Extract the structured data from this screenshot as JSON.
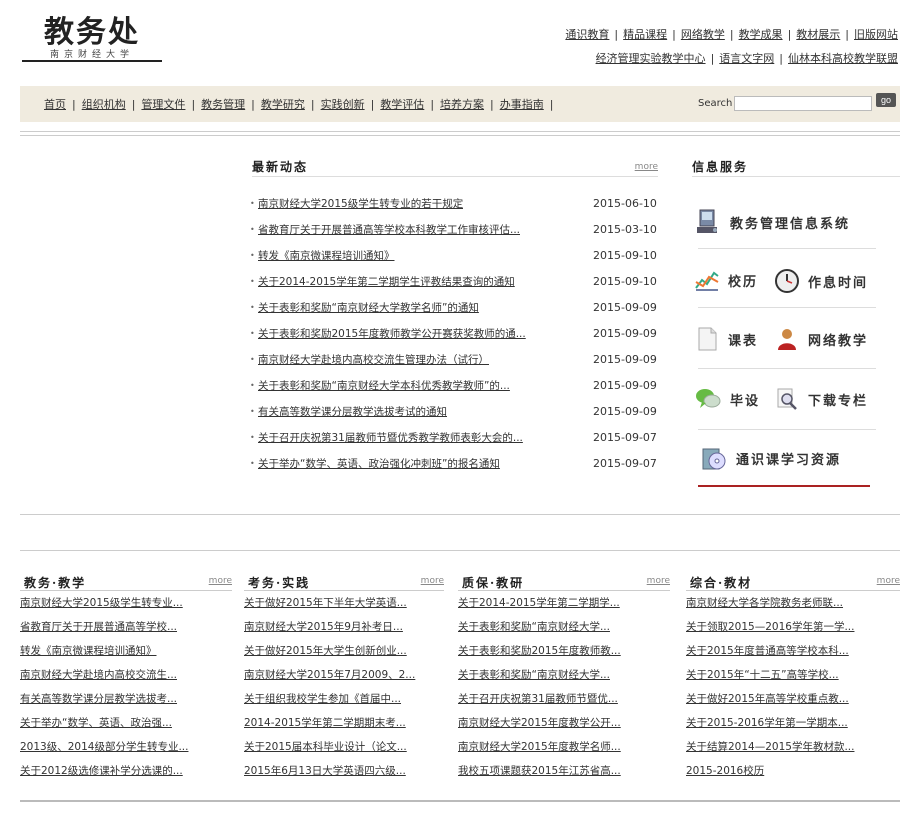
{
  "header": {
    "logo_title": "教务处",
    "logo_subtitle": "南京财经大学",
    "links_row1": [
      "通识教育",
      "精品课程",
      "网络教学",
      "教学成果",
      "教材展示",
      "旧版网站"
    ],
    "links_row2": [
      "经济管理实验教学中心",
      "语言文字网",
      "仙林本科高校教学联盟"
    ]
  },
  "nav": {
    "items": [
      "首页",
      "组织机构",
      "管理文件",
      "教务管理",
      "教学研究",
      "实践创新",
      "教学评估",
      "培养方案",
      "办事指南"
    ],
    "search_label": "Search",
    "search_value": "",
    "go_label": "go"
  },
  "news": {
    "title": "最新动态",
    "more": "more",
    "items": [
      {
        "title": "南京财经大学2015级学生转专业的若干规定",
        "date": "2015-06-10"
      },
      {
        "title": "省教育厅关于开展普通高等学校本科教学工作审核评估...",
        "date": "2015-03-10"
      },
      {
        "title": "转发《南京微课程培训通知》",
        "date": "2015-09-10"
      },
      {
        "title": "关于2014-2015学年第二学期学生评教结果查询的通知",
        "date": "2015-09-10"
      },
      {
        "title": "关于表彰和奖励“南京财经大学教学名师”的通知",
        "date": "2015-09-09"
      },
      {
        "title": "关于表彰和奖励2015年度教师教学公开赛获奖教师的通...",
        "date": "2015-09-09"
      },
      {
        "title": "南京财经大学赴境内高校交流生管理办法（试行）",
        "date": "2015-09-09"
      },
      {
        "title": "关于表彰和奖励“南京财经大学本科优秀教学教师”的...",
        "date": "2015-09-09"
      },
      {
        "title": "有关高等数学课分层教学选拔考试的通知",
        "date": "2015-09-09"
      },
      {
        "title": "关于召开庆祝第31届教师节暨优秀教学教师表彰大会的...",
        "date": "2015-09-07"
      },
      {
        "title": "关于举办“数学、英语、政治强化冲刺班”的报名通知",
        "date": "2015-09-07"
      }
    ]
  },
  "services": {
    "title": "信息服务",
    "items": [
      "教务管理信息系统",
      "校历",
      "作息时间",
      "课表",
      "网络教学",
      "毕设",
      "下载专栏",
      "通识课学习资源"
    ]
  },
  "columns": [
    {
      "title": "教务·教学",
      "more": "more",
      "items": [
        "南京财经大学2015级学生转专业...",
        "省教育厅关于开展普通高等学校...",
        "转发《南京微课程培训通知》",
        "南京财经大学赴境内高校交流生...",
        "有关高等数学课分层教学选拔考...",
        "关于举办“数学、英语、政治强...",
        "2013级、2014级部分学生转专业...",
        "关于2012级选修课补学分选课的..."
      ]
    },
    {
      "title": "考务·实践",
      "more": "more",
      "items": [
        "关于做好2015年下半年大学英语...",
        "南京财经大学2015年9月补考日...",
        "关于做好2015年大学生创新创业...",
        "南京财经大学2015年7月2009、2...",
        "关于组织我校学生参加《首届中...",
        "2014-2015学年第二学期期末考...",
        "关于2015届本科毕业设计（论文...",
        "2015年6月13日大学英语四六级..."
      ]
    },
    {
      "title": "质保·教研",
      "more": "more",
      "items": [
        "关于2014-2015学年第二学期学...",
        "关于表彰和奖励“南京财经大学...",
        "关于表彰和奖励2015年度教师教...",
        "关于表彰和奖励“南京财经大学...",
        "关于召开庆祝第31届教师节暨优...",
        "南京财经大学2015年度教学公开...",
        "南京财经大学2015年度教学名师...",
        "我校五项课题获2015年江苏省高..."
      ]
    },
    {
      "title": "综合·教材",
      "more": "more",
      "items": [
        "南京财经大学各学院教务老师联...",
        "关于领取2015—2016学年第一学...",
        "关于2015年度普通高等学校本科...",
        "关于2015年“十二五”高等学校...",
        "关于做好2015年高等学校重点教...",
        "关于2015-2016学年第一学期本...",
        "关于结算2014—2015学年教材款...",
        "2015-2016校历"
      ]
    }
  ]
}
